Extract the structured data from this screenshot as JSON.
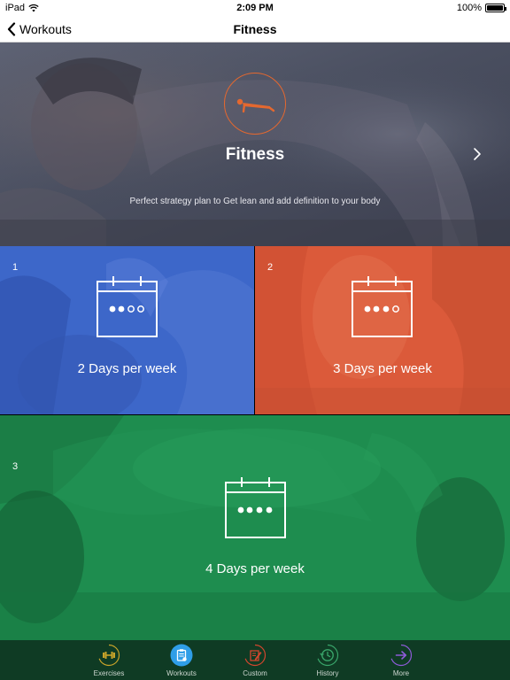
{
  "status_bar": {
    "device": "iPad",
    "time": "2:09 PM",
    "battery": "100%",
    "battery_level": 1.0
  },
  "nav": {
    "back_label": "Workouts",
    "title": "Fitness"
  },
  "hero": {
    "title": "Fitness",
    "subtitle": "Perfect strategy plan to Get lean and add definition to your body",
    "accent_color": "#e4682f"
  },
  "plans": [
    {
      "number": "1",
      "label": "2 Days per week",
      "color": "#3d67c9",
      "filled_dots": 2,
      "total_dots": 4
    },
    {
      "number": "2",
      "label": "3 Days per week",
      "color": "#db5a3a",
      "filled_dots": 3,
      "total_dots": 4
    },
    {
      "number": "3",
      "label": "4 Days per week",
      "color": "#1e8d4f",
      "filled_dots": 4,
      "total_dots": 4
    }
  ],
  "tabs": [
    {
      "label": "Exercises",
      "icon": "dumbbell-icon",
      "ring_color": "#c7a32a",
      "active": false
    },
    {
      "label": "Workouts",
      "icon": "clipboard-icon",
      "ring_color": "#2f9ee8",
      "active": true
    },
    {
      "label": "Custom",
      "icon": "notepad-pencil-icon",
      "ring_color": "#d2462e",
      "active": false
    },
    {
      "label": "History",
      "icon": "clock-history-icon",
      "ring_color": "#39a56a",
      "active": false
    },
    {
      "label": "More",
      "icon": "arrow-right-icon",
      "ring_color": "#8e5bd8",
      "active": false
    }
  ]
}
